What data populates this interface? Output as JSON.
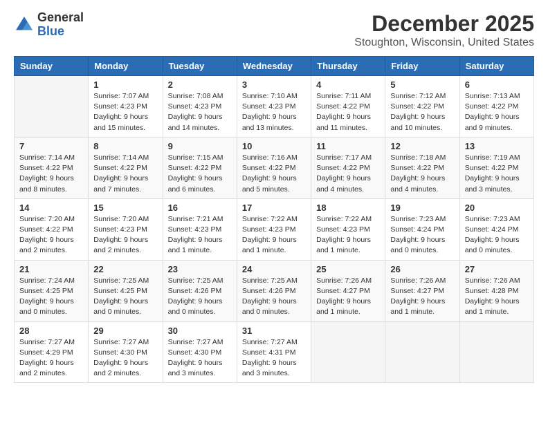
{
  "logo": {
    "general": "General",
    "blue": "Blue"
  },
  "header": {
    "title": "December 2025",
    "subtitle": "Stoughton, Wisconsin, United States"
  },
  "days_of_week": [
    "Sunday",
    "Monday",
    "Tuesday",
    "Wednesday",
    "Thursday",
    "Friday",
    "Saturday"
  ],
  "weeks": [
    [
      {
        "day": "",
        "info": ""
      },
      {
        "day": "1",
        "info": "Sunrise: 7:07 AM\nSunset: 4:23 PM\nDaylight: 9 hours\nand 15 minutes."
      },
      {
        "day": "2",
        "info": "Sunrise: 7:08 AM\nSunset: 4:23 PM\nDaylight: 9 hours\nand 14 minutes."
      },
      {
        "day": "3",
        "info": "Sunrise: 7:10 AM\nSunset: 4:23 PM\nDaylight: 9 hours\nand 13 minutes."
      },
      {
        "day": "4",
        "info": "Sunrise: 7:11 AM\nSunset: 4:22 PM\nDaylight: 9 hours\nand 11 minutes."
      },
      {
        "day": "5",
        "info": "Sunrise: 7:12 AM\nSunset: 4:22 PM\nDaylight: 9 hours\nand 10 minutes."
      },
      {
        "day": "6",
        "info": "Sunrise: 7:13 AM\nSunset: 4:22 PM\nDaylight: 9 hours\nand 9 minutes."
      }
    ],
    [
      {
        "day": "7",
        "info": "Sunrise: 7:14 AM\nSunset: 4:22 PM\nDaylight: 9 hours\nand 8 minutes."
      },
      {
        "day": "8",
        "info": "Sunrise: 7:14 AM\nSunset: 4:22 PM\nDaylight: 9 hours\nand 7 minutes."
      },
      {
        "day": "9",
        "info": "Sunrise: 7:15 AM\nSunset: 4:22 PM\nDaylight: 9 hours\nand 6 minutes."
      },
      {
        "day": "10",
        "info": "Sunrise: 7:16 AM\nSunset: 4:22 PM\nDaylight: 9 hours\nand 5 minutes."
      },
      {
        "day": "11",
        "info": "Sunrise: 7:17 AM\nSunset: 4:22 PM\nDaylight: 9 hours\nand 4 minutes."
      },
      {
        "day": "12",
        "info": "Sunrise: 7:18 AM\nSunset: 4:22 PM\nDaylight: 9 hours\nand 4 minutes."
      },
      {
        "day": "13",
        "info": "Sunrise: 7:19 AM\nSunset: 4:22 PM\nDaylight: 9 hours\nand 3 minutes."
      }
    ],
    [
      {
        "day": "14",
        "info": "Sunrise: 7:20 AM\nSunset: 4:22 PM\nDaylight: 9 hours\nand 2 minutes."
      },
      {
        "day": "15",
        "info": "Sunrise: 7:20 AM\nSunset: 4:23 PM\nDaylight: 9 hours\nand 2 minutes."
      },
      {
        "day": "16",
        "info": "Sunrise: 7:21 AM\nSunset: 4:23 PM\nDaylight: 9 hours\nand 1 minute."
      },
      {
        "day": "17",
        "info": "Sunrise: 7:22 AM\nSunset: 4:23 PM\nDaylight: 9 hours\nand 1 minute."
      },
      {
        "day": "18",
        "info": "Sunrise: 7:22 AM\nSunset: 4:23 PM\nDaylight: 9 hours\nand 1 minute."
      },
      {
        "day": "19",
        "info": "Sunrise: 7:23 AM\nSunset: 4:24 PM\nDaylight: 9 hours\nand 0 minutes."
      },
      {
        "day": "20",
        "info": "Sunrise: 7:23 AM\nSunset: 4:24 PM\nDaylight: 9 hours\nand 0 minutes."
      }
    ],
    [
      {
        "day": "21",
        "info": "Sunrise: 7:24 AM\nSunset: 4:25 PM\nDaylight: 9 hours\nand 0 minutes."
      },
      {
        "day": "22",
        "info": "Sunrise: 7:25 AM\nSunset: 4:25 PM\nDaylight: 9 hours\nand 0 minutes."
      },
      {
        "day": "23",
        "info": "Sunrise: 7:25 AM\nSunset: 4:26 PM\nDaylight: 9 hours\nand 0 minutes."
      },
      {
        "day": "24",
        "info": "Sunrise: 7:25 AM\nSunset: 4:26 PM\nDaylight: 9 hours\nand 0 minutes."
      },
      {
        "day": "25",
        "info": "Sunrise: 7:26 AM\nSunset: 4:27 PM\nDaylight: 9 hours\nand 1 minute."
      },
      {
        "day": "26",
        "info": "Sunrise: 7:26 AM\nSunset: 4:27 PM\nDaylight: 9 hours\nand 1 minute."
      },
      {
        "day": "27",
        "info": "Sunrise: 7:26 AM\nSunset: 4:28 PM\nDaylight: 9 hours\nand 1 minute."
      }
    ],
    [
      {
        "day": "28",
        "info": "Sunrise: 7:27 AM\nSunset: 4:29 PM\nDaylight: 9 hours\nand 2 minutes."
      },
      {
        "day": "29",
        "info": "Sunrise: 7:27 AM\nSunset: 4:30 PM\nDaylight: 9 hours\nand 2 minutes."
      },
      {
        "day": "30",
        "info": "Sunrise: 7:27 AM\nSunset: 4:30 PM\nDaylight: 9 hours\nand 3 minutes."
      },
      {
        "day": "31",
        "info": "Sunrise: 7:27 AM\nSunset: 4:31 PM\nDaylight: 9 hours\nand 3 minutes."
      },
      {
        "day": "",
        "info": ""
      },
      {
        "day": "",
        "info": ""
      },
      {
        "day": "",
        "info": ""
      }
    ]
  ]
}
